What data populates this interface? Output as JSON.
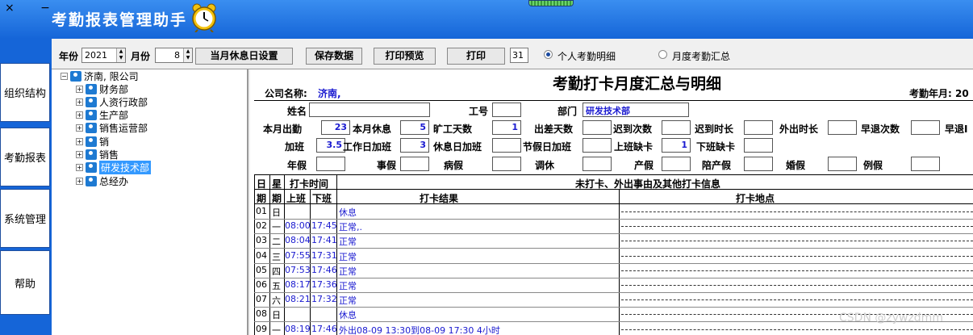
{
  "window": {
    "controls": "× −",
    "title": "考勤报表管理助手"
  },
  "left_tabs": [
    "组织结构",
    "考勤报表",
    "系统管理",
    "帮助"
  ],
  "toolbar": {
    "year_label": "年份",
    "year_value": "2021",
    "month_label": "月份",
    "month_value": "8",
    "btn_rest": "当月休息日设置",
    "btn_save": "保存数据",
    "btn_preview": "打印预览",
    "btn_print": "打印",
    "days_value": "31",
    "radio_personal": "个人考勤明细",
    "radio_monthly": "月度考勤汇总",
    "selected": "personal"
  },
  "tree": {
    "root": "济南,                       限公司",
    "nodes": [
      {
        "label": "财务部",
        "selected": false
      },
      {
        "label": "人资行政部",
        "selected": false
      },
      {
        "label": "生产部",
        "selected": false
      },
      {
        "label": "销售运营部",
        "selected": false
      },
      {
        "label": "销",
        "selected": false
      },
      {
        "label": "销售",
        "selected": false
      },
      {
        "label": "研发技术部",
        "selected": true
      },
      {
        "label": "总经办",
        "selected": false
      }
    ]
  },
  "report": {
    "title": "考勤打卡月度汇总与明细",
    "company_label": "公司名称:",
    "company_value": "济南,",
    "year_month_label": "考勤年月: 20",
    "name_label": "姓名",
    "id_label": "工号",
    "dept_label": "部门",
    "dept_value": "研发技术部",
    "stats_row1": [
      {
        "label": "本月出勤",
        "value": "23"
      },
      {
        "label": "本月休息",
        "value": "5"
      },
      {
        "label": "旷工天数",
        "value": "1"
      },
      {
        "label": "出差天数",
        "value": ""
      },
      {
        "label": "迟到次数",
        "value": ""
      },
      {
        "label": "迟到时长",
        "value": ""
      },
      {
        "label": "外出时长",
        "value": ""
      },
      {
        "label": "早退次数",
        "value": ""
      },
      {
        "label": "早退I",
        "value": ""
      }
    ],
    "stats_row2": [
      {
        "label": "加班",
        "value": "3.5"
      },
      {
        "label": "工作日加班",
        "value": "3"
      },
      {
        "label": "休息日加班",
        "value": ""
      },
      {
        "label": "节假日加班",
        "value": ""
      },
      {
        "label": "上班缺卡",
        "value": "1"
      },
      {
        "label": "下班缺卡",
        "value": ""
      }
    ],
    "stats_row3": [
      {
        "label": "年假",
        "value": ""
      },
      {
        "label": "事假",
        "value": ""
      },
      {
        "label": "病假",
        "value": ""
      },
      {
        "label": "调休",
        "value": ""
      },
      {
        "label": "产假",
        "value": ""
      },
      {
        "label": "陪产假",
        "value": ""
      },
      {
        "label": "婚假",
        "value": ""
      },
      {
        "label": "例假",
        "value": ""
      }
    ],
    "table_headers": {
      "day": "日",
      "week": "星",
      "punch_time": "打卡时间",
      "info": "未打卡、外出事由及其他打卡信息",
      "period": "期",
      "weekday": "期",
      "on": "上班",
      "off": "下班",
      "result": "打卡结果",
      "location": "打卡地点"
    },
    "rows": [
      {
        "day": "01",
        "week": "日",
        "on": "",
        "off": "",
        "result": "休息"
      },
      {
        "day": "02",
        "week": "一",
        "on": "08:00",
        "off": "17:45",
        "result": "正常,."
      },
      {
        "day": "03",
        "week": "二",
        "on": "08:04",
        "off": "17:41",
        "result": "正常"
      },
      {
        "day": "04",
        "week": "三",
        "on": "07:55",
        "off": "17:31",
        "result": "正常"
      },
      {
        "day": "05",
        "week": "四",
        "on": "07:53",
        "off": "17:46",
        "result": "正常"
      },
      {
        "day": "06",
        "week": "五",
        "on": "08:17",
        "off": "17:36",
        "result": "正常"
      },
      {
        "day": "07",
        "week": "六",
        "on": "08:21",
        "off": "17:32",
        "result": "正常"
      },
      {
        "day": "08",
        "week": "日",
        "on": "",
        "off": "",
        "result": "休息"
      },
      {
        "day": "09",
        "week": "一",
        "on": "08:19",
        "off": "17:46",
        "result": "外出08-09 13:30到08-09 17:30 4小时"
      }
    ]
  },
  "watermark": "CSDN @zywzdmm",
  "colors": {
    "titlebar": "#1565d8",
    "accent_text": "#1a1ad0",
    "selection": "#3399ff"
  }
}
